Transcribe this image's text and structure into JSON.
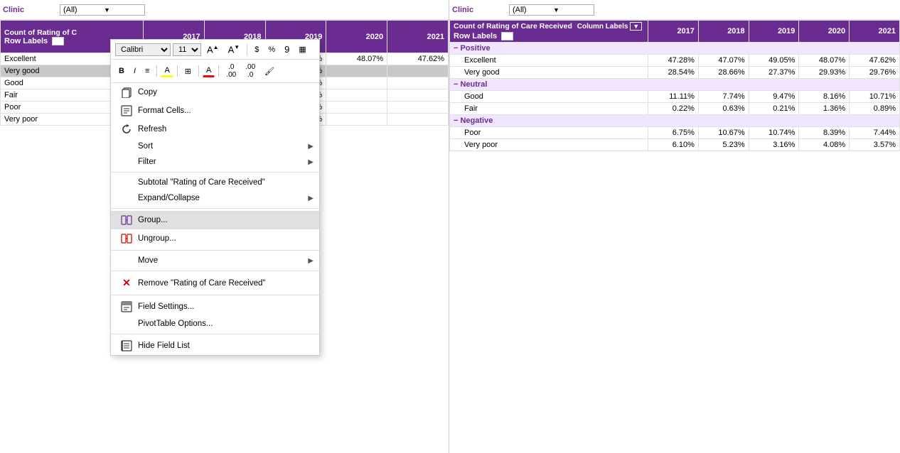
{
  "left_pivot": {
    "clinic_label": "Clinic",
    "filter_value": "(All)",
    "header": {
      "count_label": "Count of Rating of C",
      "row_labels": "Row Labels",
      "years": [
        "2017",
        "2018",
        "2019",
        "2020",
        "2021"
      ]
    },
    "rows": [
      {
        "label": "Excellent",
        "selected": false,
        "values": [
          "",
          "",
          "49.05%",
          "48.07%",
          "47.62%"
        ]
      },
      {
        "label": "Very good",
        "selected": true,
        "values": [
          "27.37%",
          "29.93%",
          "29.76%",
          "",
          ""
        ]
      },
      {
        "label": "Good",
        "selected": false,
        "values": [
          "9.47%",
          "8.16%",
          "10.71%",
          "",
          ""
        ]
      },
      {
        "label": "Fair",
        "selected": false,
        "values": [
          "0.21%",
          "1.36%",
          "0.89%",
          "",
          ""
        ]
      },
      {
        "label": "Poor",
        "selected": false,
        "values": [
          "10.74%",
          "8.39%",
          "7.44%",
          "",
          ""
        ]
      },
      {
        "label": "Very poor",
        "selected": false,
        "values": [
          "3.16%",
          "4.08%",
          "3.57%",
          "",
          ""
        ]
      }
    ]
  },
  "right_pivot": {
    "clinic_label": "Clinic",
    "filter_value": "(All)",
    "header": {
      "count_label": "Count of Rating of Care Received",
      "col_labels": "Column Labels",
      "row_labels": "Row Labels",
      "years": [
        "2017",
        "2018",
        "2019",
        "2020",
        "2021"
      ]
    },
    "groups": [
      {
        "name": "Positive",
        "symbol": "−",
        "rows": [
          {
            "label": "Excellent",
            "values": [
              "47.28%",
              "47.07%",
              "49.05%",
              "48.07%",
              "47.62%"
            ]
          },
          {
            "label": "Very good",
            "values": [
              "28.54%",
              "28.66%",
              "27.37%",
              "29.93%",
              "29.76%"
            ]
          }
        ]
      },
      {
        "name": "Neutral",
        "symbol": "−",
        "rows": [
          {
            "label": "Good",
            "values": [
              "11.11%",
              "7.74%",
              "9.47%",
              "8.16%",
              "10.71%"
            ]
          },
          {
            "label": "Fair",
            "values": [
              "0.22%",
              "0.63%",
              "0.21%",
              "1.36%",
              "0.89%"
            ]
          }
        ]
      },
      {
        "name": "Negative",
        "symbol": "−",
        "rows": [
          {
            "label": "Poor",
            "values": [
              "6.75%",
              "10.67%",
              "10.74%",
              "8.39%",
              "7.44%"
            ]
          },
          {
            "label": "Very poor",
            "values": [
              "6.10%",
              "5.23%",
              "3.16%",
              "4.08%",
              "3.57%"
            ]
          }
        ]
      }
    ]
  },
  "context_menu": {
    "font_family": "Calibri",
    "font_size": "11",
    "items": [
      {
        "id": "copy",
        "label": "Copy",
        "icon": "copy",
        "has_submenu": false
      },
      {
        "id": "format-cells",
        "label": "Format Cells...",
        "icon": "format",
        "has_submenu": false
      },
      {
        "id": "refresh",
        "label": "Refresh",
        "icon": "refresh",
        "has_submenu": false
      },
      {
        "id": "sort",
        "label": "Sort",
        "icon": "",
        "has_submenu": true
      },
      {
        "id": "filter",
        "label": "Filter",
        "icon": "",
        "has_submenu": true
      },
      {
        "id": "subtotal",
        "label": "Subtotal \"Rating of Care Received\"",
        "icon": "",
        "has_submenu": false
      },
      {
        "id": "expand-collapse",
        "label": "Expand/Collapse",
        "icon": "",
        "has_submenu": true
      },
      {
        "id": "group",
        "label": "Group...",
        "icon": "group",
        "has_submenu": false,
        "active": true
      },
      {
        "id": "ungroup",
        "label": "Ungroup...",
        "icon": "ungroup",
        "has_submenu": false
      },
      {
        "id": "move",
        "label": "Move",
        "icon": "",
        "has_submenu": true
      },
      {
        "id": "remove",
        "label": "Remove \"Rating of Care Received\"",
        "icon": "x",
        "has_submenu": false
      },
      {
        "id": "field-settings",
        "label": "Field Settings...",
        "icon": "field",
        "has_submenu": false
      },
      {
        "id": "pivottable-options",
        "label": "PivotTable Options...",
        "icon": "",
        "has_submenu": false
      },
      {
        "id": "hide-field-list",
        "label": "Hide Field List",
        "icon": "list",
        "has_submenu": false
      }
    ]
  }
}
